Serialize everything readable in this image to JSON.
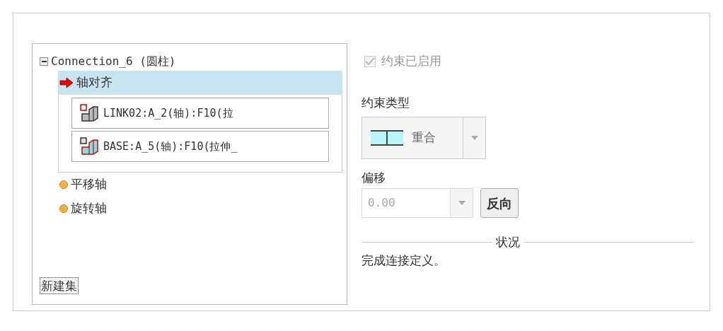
{
  "tree": {
    "label": "Connection_6 (圆柱)",
    "expanded": true,
    "children": [
      {
        "label": "轴对齐",
        "kind": "current",
        "selected": true,
        "references": [
          {
            "label": "LINK02:A_2(轴):F10(拉",
            "kind": "link"
          },
          {
            "label": "BASE:A_5(轴):F10(拉伸_",
            "kind": "base"
          }
        ]
      },
      {
        "label": "平移轴",
        "kind": "pending",
        "selected": false
      },
      {
        "label": "旋转轴",
        "kind": "pending",
        "selected": false
      }
    ]
  },
  "new_set_link": "新建集",
  "constraint_enabled": {
    "label": "约束已启用",
    "checked": true,
    "disabled": true
  },
  "constraint_type": {
    "label": "约束类型",
    "value": "重合"
  },
  "offset": {
    "label": "偏移",
    "value": "0.00",
    "disabled": true,
    "button": "反向"
  },
  "status": {
    "title": "状况",
    "message": "完成连接定义。"
  }
}
